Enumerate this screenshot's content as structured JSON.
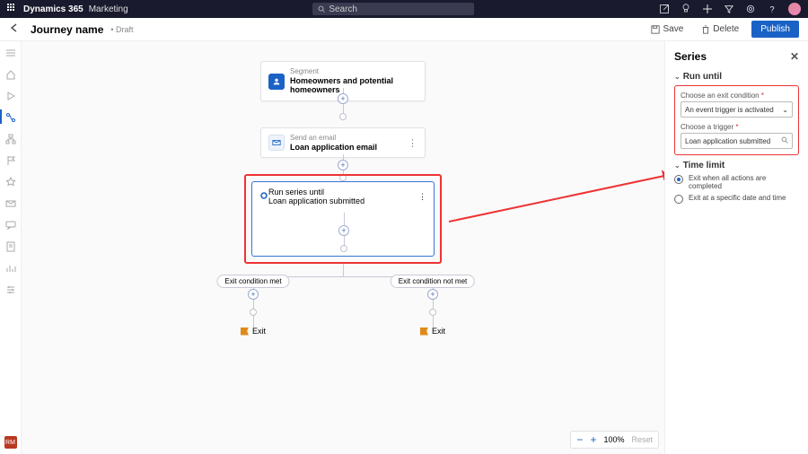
{
  "topbar": {
    "brand": "Dynamics 365",
    "module": "Marketing",
    "search_placeholder": "Search"
  },
  "cmdbar": {
    "title": "Journey name",
    "status": "• Draft",
    "save": "Save",
    "delete": "Delete",
    "publish": "Publish"
  },
  "canvas": {
    "segment": {
      "meta": "Segment",
      "label": "Homeowners and potential homeowners"
    },
    "email": {
      "meta": "Send an email",
      "label": "Loan application email"
    },
    "series": {
      "meta": "Run series until",
      "label": "Loan application submitted"
    },
    "branch_met": "Exit condition met",
    "branch_not": "Exit condition not met",
    "exit": "Exit",
    "zoom": {
      "pct": "100%",
      "reset": "Reset"
    }
  },
  "panel": {
    "title": "Series",
    "section1": "Run until",
    "exit_label": "Choose an exit condition",
    "exit_value": "An event trigger is activated",
    "trigger_label": "Choose a trigger",
    "trigger_value": "Loan application submitted",
    "section2": "Time limit",
    "radio_all": "Exit when all actions are completed",
    "radio_date": "Exit at a specific date and time"
  },
  "leftrail_badge": "RM"
}
